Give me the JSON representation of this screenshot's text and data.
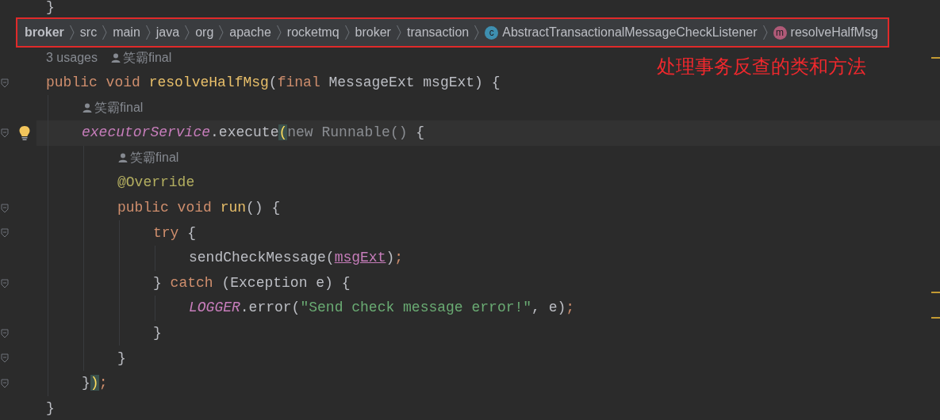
{
  "breadcrumbs": [
    {
      "kind": "module",
      "label": "broker"
    },
    {
      "kind": "folder",
      "label": "src"
    },
    {
      "kind": "folder",
      "label": "main"
    },
    {
      "kind": "folder",
      "label": "java"
    },
    {
      "kind": "folder",
      "label": "org"
    },
    {
      "kind": "folder",
      "label": "apache"
    },
    {
      "kind": "folder",
      "label": "rocketmq"
    },
    {
      "kind": "folder",
      "label": "broker"
    },
    {
      "kind": "folder",
      "label": "transaction"
    },
    {
      "kind": "class",
      "icon_letter": "c",
      "label": "AbstractTransactionalMessageCheckListener"
    },
    {
      "kind": "method",
      "icon_letter": "m",
      "label": "resolveHalfMsg"
    }
  ],
  "annotation_note": "处理事务反查的类和方法",
  "code": [
    {
      "kind": "code",
      "tokens": [
        {
          "kind": "plain",
          "s": "}"
        }
      ]
    },
    {
      "kind": "blank"
    },
    {
      "kind": "hint",
      "usages": "3 usages",
      "author": "笑霸final"
    },
    {
      "kind": "code",
      "fold": true,
      "tokens": [
        {
          "kind": "kw",
          "s": "public void "
        },
        {
          "kind": "decl",
          "s": "resolveHalfMsg"
        },
        {
          "kind": "plain",
          "s": "("
        },
        {
          "kind": "kw",
          "s": "final "
        },
        {
          "kind": "plain",
          "s": "MessageExt msgExt) {"
        }
      ],
      "children": [
        {
          "kind": "hint",
          "author": "笑霸final"
        },
        {
          "kind": "code",
          "fold": true,
          "current": true,
          "bulb": true,
          "tokens": [
            {
              "kind": "field",
              "s": "executorService"
            },
            {
              "kind": "plain",
              "s": ".execute"
            },
            {
              "kind": "match",
              "s": "("
            },
            {
              "kind": "dim",
              "s": "new Runnable() "
            },
            {
              "kind": "plain",
              "s": "{"
            }
          ],
          "children": [
            {
              "kind": "hint",
              "author": "笑霸final"
            },
            {
              "kind": "code",
              "tokens": [
                {
                  "kind": "annotation",
                  "s": "@Override"
                }
              ]
            },
            {
              "kind": "code",
              "fold": true,
              "tokens": [
                {
                  "kind": "kw",
                  "s": "public void "
                },
                {
                  "kind": "decl",
                  "s": "run"
                },
                {
                  "kind": "plain",
                  "s": "() {"
                }
              ],
              "children": [
                {
                  "kind": "code",
                  "fold": true,
                  "tokens": [
                    {
                      "kind": "kw",
                      "s": "try "
                    },
                    {
                      "kind": "plain",
                      "s": "{"
                    }
                  ],
                  "children": [
                    {
                      "kind": "code",
                      "tokens": [
                        {
                          "kind": "plain",
                          "s": "sendCheckMessage("
                        },
                        {
                          "kind": "param",
                          "s": "msgExt"
                        },
                        {
                          "kind": "plain",
                          "s": ")"
                        },
                        {
                          "kind": "kw",
                          "s": ";"
                        }
                      ]
                    }
                  ]
                },
                {
                  "kind": "code",
                  "fold": true,
                  "tokens": [
                    {
                      "kind": "plain",
                      "s": "} "
                    },
                    {
                      "kind": "kw",
                      "s": "catch "
                    },
                    {
                      "kind": "plain",
                      "s": "(Exception e) {"
                    }
                  ],
                  "children": [
                    {
                      "kind": "code",
                      "tokens": [
                        {
                          "kind": "field",
                          "s": "LOGGER"
                        },
                        {
                          "kind": "plain",
                          "s": ".error("
                        },
                        {
                          "kind": "string",
                          "s": "\"Send check message error!\""
                        },
                        {
                          "kind": "plain",
                          "s": ", e)"
                        },
                        {
                          "kind": "kw",
                          "s": ";"
                        }
                      ]
                    }
                  ]
                },
                {
                  "kind": "code",
                  "fold": true,
                  "tokens": [
                    {
                      "kind": "plain",
                      "s": "}"
                    }
                  ]
                }
              ]
            },
            {
              "kind": "code",
              "fold": true,
              "tokens": [
                {
                  "kind": "plain",
                  "s": "}"
                }
              ]
            }
          ]
        },
        {
          "kind": "code",
          "fold": true,
          "tokens": [
            {
              "kind": "plain",
              "s": "}"
            },
            {
              "kind": "match",
              "s": ")"
            },
            {
              "kind": "kw",
              "s": ";"
            }
          ]
        }
      ]
    },
    {
      "kind": "code",
      "tokens": [
        {
          "kind": "plain",
          "s": "}"
        }
      ]
    }
  ]
}
